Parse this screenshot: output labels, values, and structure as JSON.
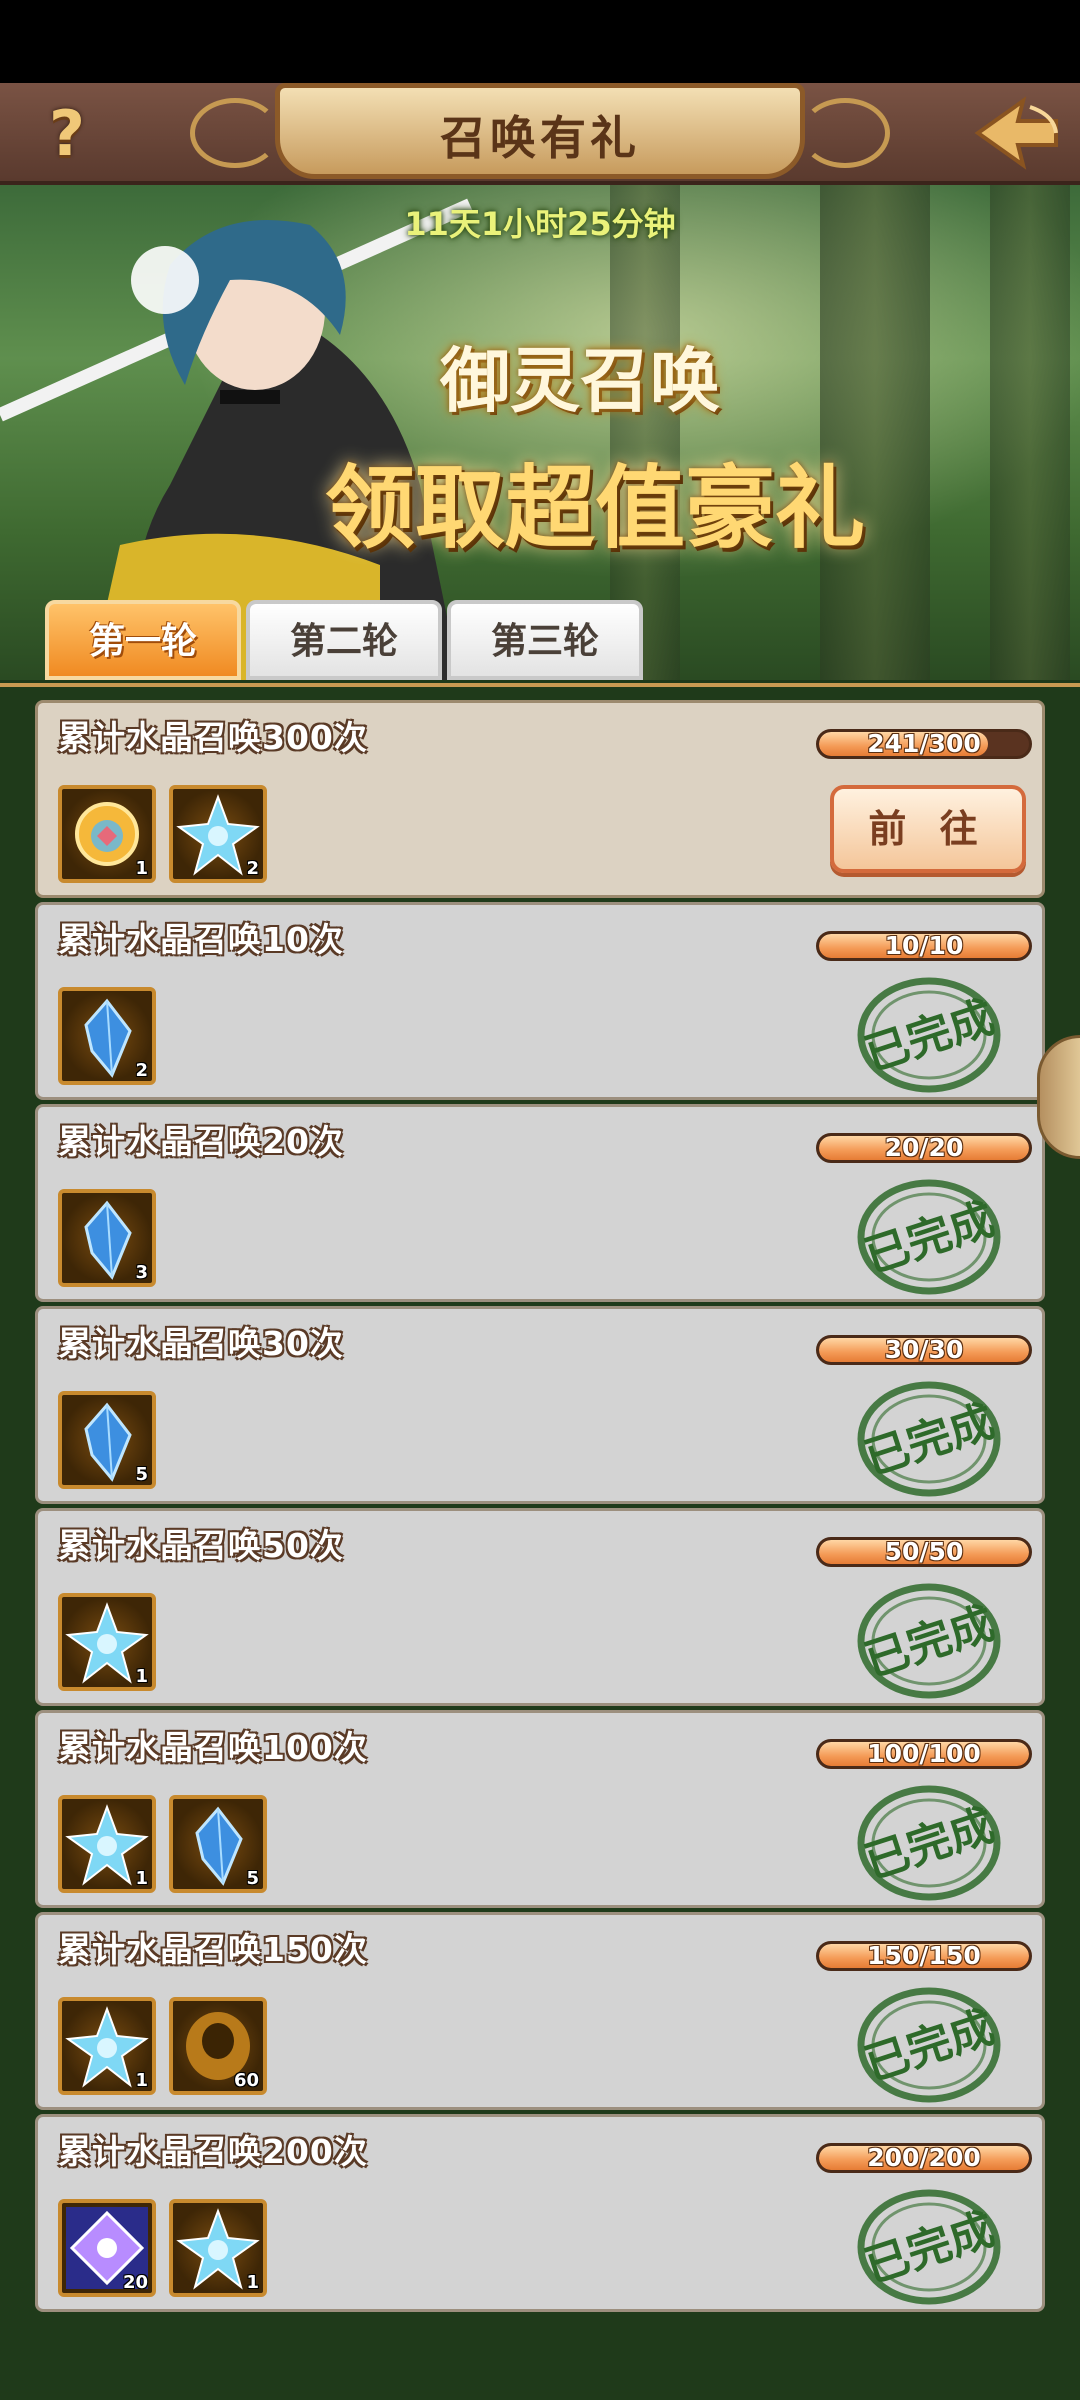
{
  "header": {
    "title": "召唤有礼",
    "help_icon": "?"
  },
  "banner": {
    "countdown": "11天1小时25分钟",
    "subtitle": "御灵召唤",
    "headline": "领取超值豪礼"
  },
  "tabs": [
    {
      "label": "第一轮",
      "active": true
    },
    {
      "label": "第二轮",
      "active": false
    },
    {
      "label": "第三轮",
      "active": false
    }
  ],
  "tasks": [
    {
      "title": "累计水晶召唤300次",
      "progress": "241/300",
      "current": 241,
      "total": 300,
      "status": "go",
      "action_label": "前 往",
      "rewards": [
        {
          "icon": "gold-orb-icon",
          "count": "1"
        },
        {
          "icon": "blue-crystal-star-icon",
          "count": "2"
        }
      ]
    },
    {
      "title": "累计水晶召唤10次",
      "progress": "10/10",
      "current": 10,
      "total": 10,
      "status": "done",
      "stamp_label": "已完成",
      "rewards": [
        {
          "icon": "blue-gem-icon",
          "count": "2"
        }
      ]
    },
    {
      "title": "累计水晶召唤20次",
      "progress": "20/20",
      "current": 20,
      "total": 20,
      "status": "done",
      "stamp_label": "已完成",
      "rewards": [
        {
          "icon": "blue-gem-icon",
          "count": "3"
        }
      ]
    },
    {
      "title": "累计水晶召唤30次",
      "progress": "30/30",
      "current": 30,
      "total": 30,
      "status": "done",
      "stamp_label": "已完成",
      "rewards": [
        {
          "icon": "blue-gem-icon",
          "count": "5"
        }
      ]
    },
    {
      "title": "累计水晶召唤50次",
      "progress": "50/50",
      "current": 50,
      "total": 50,
      "status": "done",
      "stamp_label": "已完成",
      "rewards": [
        {
          "icon": "blue-crystal-star-icon",
          "count": "1"
        }
      ]
    },
    {
      "title": "累计水晶召唤100次",
      "progress": "100/100",
      "current": 100,
      "total": 100,
      "status": "done",
      "stamp_label": "已完成",
      "rewards": [
        {
          "icon": "blue-crystal-star-icon",
          "count": "1"
        },
        {
          "icon": "blue-gem-icon",
          "count": "5"
        }
      ]
    },
    {
      "title": "累计水晶召唤150次",
      "progress": "150/150",
      "current": 150,
      "total": 150,
      "status": "done",
      "stamp_label": "已完成",
      "rewards": [
        {
          "icon": "blue-crystal-star-icon",
          "count": "1"
        },
        {
          "icon": "gold-shard-icon",
          "count": "60"
        }
      ]
    },
    {
      "title": "累计水晶召唤200次",
      "progress": "200/200",
      "current": 200,
      "total": 200,
      "status": "done",
      "stamp_label": "已完成",
      "rewards": [
        {
          "icon": "purple-diamond-icon",
          "count": "20"
        },
        {
          "icon": "blue-crystal-star-icon",
          "count": "1"
        }
      ]
    }
  ],
  "colors": {
    "accent_orange": "#f08a22",
    "stamp_green": "#2e6a2a",
    "header_brown": "#6a4536"
  }
}
